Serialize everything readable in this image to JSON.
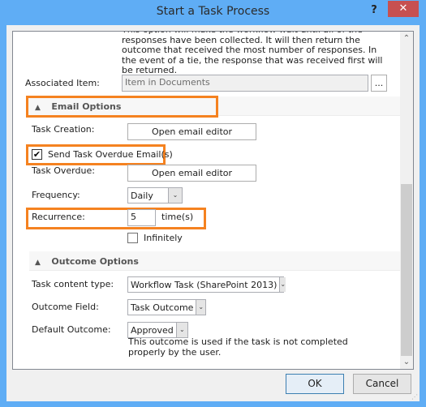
{
  "window": {
    "title": "Start a Task Process",
    "help_label": "?",
    "close_label": "✕"
  },
  "description_top": "This option will make the workflow wait until all of the responses have been collected. It will then return the outcome that received the most number of responses. In the event of a tie, the response that was received first will be returned.",
  "associated_item": {
    "label": "Associated Item:",
    "value": "Item in Documents",
    "browse_label": "..."
  },
  "email_options": {
    "header": "Email Options",
    "chevron": "▲",
    "task_creation_label": "Task Creation:",
    "task_creation_button": "Open email editor",
    "send_overdue_label": "Send Task Overdue Email(s)",
    "send_overdue_checked": true,
    "check_glyph": "✔",
    "task_overdue_label": "Task Overdue:",
    "task_overdue_button": "Open email editor",
    "frequency_label": "Frequency:",
    "frequency_value": "Daily",
    "recurrence_label": "Recurrence:",
    "recurrence_value": "5",
    "recurrence_unit": "time(s)",
    "infinitely_label": "Infinitely",
    "infinitely_checked": false
  },
  "outcome_options": {
    "header": "Outcome Options",
    "chevron": "▲",
    "content_type_label": "Task content type:",
    "content_type_value": "Workflow Task (SharePoint 2013)",
    "outcome_field_label": "Outcome Field:",
    "outcome_field_value": "Task Outcome",
    "default_outcome_label": "Default Outcome:",
    "default_outcome_value": "Approved",
    "default_outcome_help": "This outcome is used if the task is not completed properly by the user."
  },
  "icons": {
    "dropdown": "⌄",
    "scroll_up": "⌃",
    "scroll_down": "⌄",
    "grip": "⋰"
  },
  "footer": {
    "ok_label": "OK",
    "cancel_label": "Cancel"
  },
  "colors": {
    "titlebar": "#5fadf5",
    "close": "#c75050",
    "highlight": "#f58220"
  }
}
